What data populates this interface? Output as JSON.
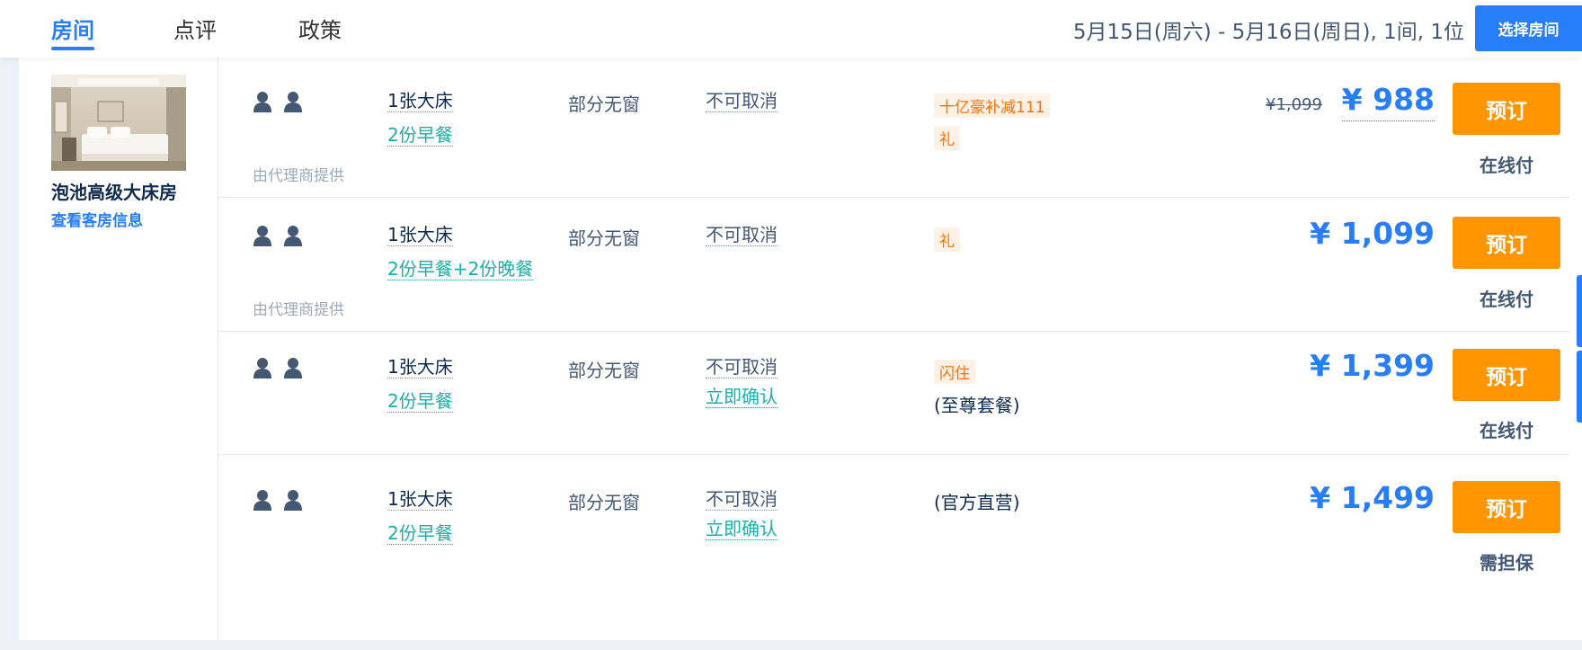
{
  "nav": {
    "tabs": [
      {
        "label": "房间"
      },
      {
        "label": "点评"
      },
      {
        "label": "政策"
      }
    ],
    "date_summary": "5月15日(周六) - 5月16日(周日), 1间, 1位",
    "select_room_label": "选择房间"
  },
  "room": {
    "name": "泡池高级大床房",
    "info_link": "查看客房信息"
  },
  "rates": [
    {
      "bed": "1张大床",
      "meal": "2份早餐",
      "window": "部分无窗",
      "cancel": "不可取消",
      "tags": [
        "十亿豪补减111",
        "礼"
      ],
      "original_price": "¥1,099",
      "price": "¥ 988",
      "book_label": "预订",
      "payment": "在线付",
      "provider": "由代理商提供"
    },
    {
      "bed": "1张大床",
      "meal": "2份早餐+2份晚餐",
      "window": "部分无窗",
      "cancel": "不可取消",
      "tags": [
        "礼"
      ],
      "price": "¥ 1,099",
      "book_label": "预订",
      "payment": "在线付",
      "provider": "由代理商提供"
    },
    {
      "bed": "1张大床",
      "meal": "2份早餐",
      "window": "部分无窗",
      "cancel": "不可取消",
      "confirm": "立即确认",
      "tags": [
        "闪住"
      ],
      "package": "(至尊套餐)",
      "price": "¥ 1,399",
      "book_label": "预订",
      "payment": "在线付"
    },
    {
      "bed": "1张大床",
      "meal": "2份早餐",
      "window": "部分无窗",
      "cancel": "不可取消",
      "confirm": "立即确认",
      "package": "(官方直营)",
      "price": "¥ 1,499",
      "book_label": "预订",
      "payment": "需担保"
    }
  ],
  "colors": {
    "accent": "#287dfa",
    "book_button": "#ff9500",
    "meal_link": "#1ab0aa",
    "promo_tag": "#ff6f00"
  }
}
